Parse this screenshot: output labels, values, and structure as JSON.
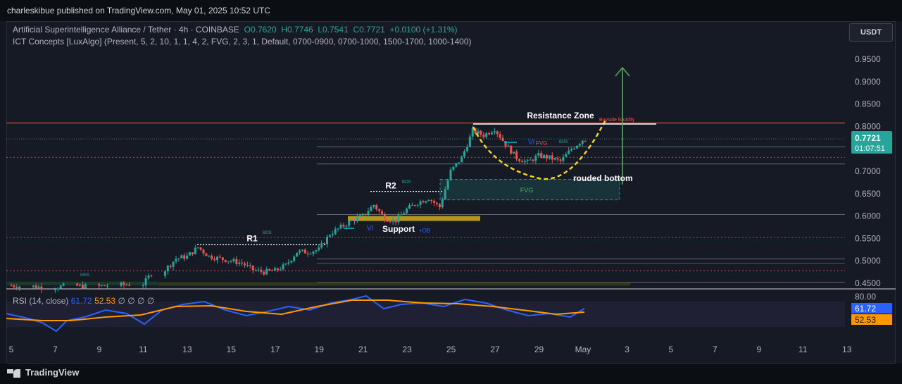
{
  "header": {
    "publisher_text": "charleskibue published on TradingView.com, May 01, 2025 10:52 UTC"
  },
  "symbol": {
    "name": "Artificial Superintelligence Alliance / Tether · 4h · COINBASE",
    "open": "O0.7620",
    "high": "H0.7746",
    "low": "L0.7541",
    "close": "C0.7721",
    "change": "+0.0100 (+1.31%)"
  },
  "indicator": {
    "name": "ICT Concepts [LuxAlgo] (Present, 5, 2, 10, 1, 1, 4, 2, FVG, 2, 3, 1, Default, 0700-0900, 0700-1000, 1500-1700, 1000-1400)"
  },
  "currency_button": "USDT",
  "price_badge": {
    "value": "0.7721",
    "countdown": "01:07:51"
  },
  "rsi": {
    "label": "RSI (14, close)",
    "value": "61.72",
    "ma": "52.53",
    "extra": "∅ ∅ ∅ ∅",
    "axis_top": "80.00",
    "badge_rsi": "61.72",
    "badge_ma": "52.53"
  },
  "annotations": {
    "resistance": "Resistance Zone",
    "buyside": "Buyside liquidity",
    "rounded": "rouded bottom",
    "support": "Support",
    "ob": "+OB",
    "r1": "R1",
    "r2": "R2",
    "fvg_lower": "FVG",
    "fvg_upper": "FVG",
    "vi1": "VI",
    "vi2": "VI",
    "bos1": "BOS",
    "bos2": "BOS",
    "bos3": "BOS",
    "mss": "MSS"
  },
  "footer": {
    "brand": "TradingView"
  },
  "colors": {
    "up": "#26a69a",
    "down": "#ef5350",
    "yellow": "#f0d22a",
    "rsi": "#2962ff",
    "rsi_ma": "#ff9800",
    "arrow": "#4caf50"
  },
  "chart_data": {
    "type": "candlestick",
    "y_ticks": [
      "0.9500",
      "0.9000",
      "0.8500",
      "0.8000",
      "0.7500",
      "0.7000",
      "0.6500",
      "0.6000",
      "0.5500",
      "0.5000",
      "0.4500"
    ],
    "x_ticks": [
      "5",
      "7",
      "9",
      "11",
      "13",
      "15",
      "17",
      "19",
      "21",
      "23",
      "25",
      "27",
      "29",
      "May",
      "3",
      "5",
      "7",
      "9",
      "11",
      "13"
    ],
    "ylim": [
      0.44,
      0.98
    ],
    "resistance_level": 0.806,
    "fvg_zone": [
      0.636,
      0.682
    ],
    "support_zone": [
      0.589,
      0.6
    ],
    "r1_level": 0.536,
    "r2_level": 0.655,
    "ohlc_close_path": [
      [
        5,
        0.445
      ],
      [
        6,
        0.443
      ],
      [
        7,
        0.441
      ],
      [
        8,
        0.444
      ],
      [
        9,
        0.443
      ],
      [
        10,
        0.446
      ],
      [
        11,
        0.448
      ],
      [
        12,
        0.48
      ],
      [
        12.5,
        0.505
      ],
      [
        13,
        0.51
      ],
      [
        13.5,
        0.53
      ],
      [
        14,
        0.51
      ],
      [
        14.5,
        0.505
      ],
      [
        15,
        0.5
      ],
      [
        15.5,
        0.495
      ],
      [
        16,
        0.48
      ],
      [
        16.5,
        0.475
      ],
      [
        17,
        0.478
      ],
      [
        17.5,
        0.49
      ],
      [
        18,
        0.52
      ],
      [
        18.5,
        0.52
      ],
      [
        19,
        0.525
      ],
      [
        19.5,
        0.56
      ],
      [
        20,
        0.575
      ],
      [
        20.5,
        0.59
      ],
      [
        21,
        0.6
      ],
      [
        21.5,
        0.625
      ],
      [
        22,
        0.595
      ],
      [
        22.5,
        0.59
      ],
      [
        23,
        0.615
      ],
      [
        23.5,
        0.63
      ],
      [
        24,
        0.64
      ],
      [
        24.5,
        0.62
      ],
      [
        25,
        0.7
      ],
      [
        25.5,
        0.73
      ],
      [
        26,
        0.79
      ],
      [
        26.5,
        0.78
      ],
      [
        27,
        0.795
      ],
      [
        27.5,
        0.76
      ],
      [
        28,
        0.73
      ],
      [
        28.5,
        0.72
      ],
      [
        29,
        0.735
      ],
      [
        29.5,
        0.73
      ],
      [
        30,
        0.722
      ],
      [
        30.5,
        0.75
      ],
      [
        31,
        0.77
      ]
    ]
  }
}
